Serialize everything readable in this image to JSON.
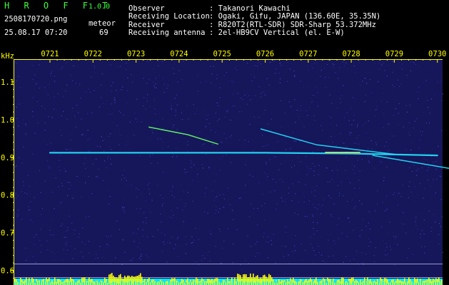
{
  "header": {
    "app_name": "H R O F F T",
    "version": "1.0.0",
    "filename": "2508170720.png",
    "timestamp": "25.08.17 07:20",
    "meteor_label": "meteor",
    "meteor_count": "69",
    "info_labels": [
      "Observer",
      "Receiving Location",
      "Receiver",
      "Receiving antenna"
    ],
    "info_values": [
      ": Takanori Kawachi",
      ": Ogaki, Gifu, JAPAN (136.60E, 35.35N)",
      ": R820T2(RTL-SDR) SDR-Sharp 53.372MHz",
      ": 2el-HB9CV Vertical (el. E-W)"
    ]
  },
  "colors": {
    "background": "#000000",
    "plot_background": "#16165a",
    "axis_text": "#ffff00",
    "signal_cyan": "#22e6ff",
    "signal_green": "#66ff66",
    "signal_yellow": "#ffff44"
  },
  "chart_data": {
    "type": "heatmap",
    "ylabel": "kHz",
    "x_ticks": [
      "0721",
      "0722",
      "0723",
      "0724",
      "0725",
      "0726",
      "0727",
      "0728",
      "0729",
      "0730"
    ],
    "y_ticks": [
      "1.1",
      "1.0",
      "0.9",
      "0.8",
      "0.7",
      "0.6"
    ],
    "ylim": [
      0.59,
      1.16
    ],
    "series": [
      {
        "values": [
          [
            0,
            0.912
          ],
          [
            3,
            0.912
          ],
          [
            5,
            0.912
          ],
          [
            7,
            0.91
          ],
          [
            9,
            0.905
          ]
        ]
      },
      {
        "values": [
          [
            2.3,
            0.98
          ],
          [
            3.2,
            0.96
          ],
          [
            3.9,
            0.935
          ]
        ]
      },
      {
        "values": [
          [
            4.9,
            0.975
          ],
          [
            6.2,
            0.933
          ],
          [
            8.0,
            0.908
          ]
        ]
      },
      {
        "values": [
          [
            6.4,
            0.913
          ],
          [
            7.2,
            0.913
          ]
        ]
      },
      {
        "values": [
          [
            7.5,
            0.905
          ],
          [
            8.8,
            0.88
          ],
          [
            9.3,
            0.87
          ]
        ]
      }
    ]
  }
}
